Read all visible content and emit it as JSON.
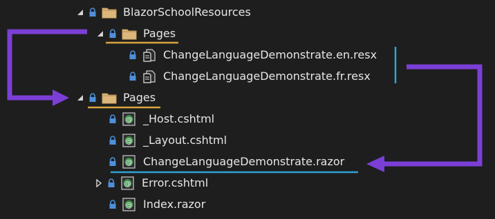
{
  "tree": {
    "root_folder": "BlazorSchoolResources",
    "resources_pages_folder": "Pages",
    "resx_files": [
      "ChangeLanguageDemonstrate.en.resx",
      "ChangeLanguageDemonstrate.fr.resx"
    ],
    "pages_folder": "Pages",
    "page_files": [
      "_Host.cshtml",
      "_Layout.cshtml",
      "ChangeLanguageDemonstrate.razor",
      "Error.cshtml",
      "Index.razor"
    ]
  },
  "colors": {
    "background": "#1e1e1e",
    "folder_underline": "#d9a441",
    "file_underline": "#2fa3d6",
    "arrow": "#7b3fd6",
    "lock": "#4e8fd9",
    "folder": "#dcb67a",
    "razor_icon": "#3c8f4a"
  },
  "icons": {
    "expanded": "triangle-down-icon",
    "collapsed": "triangle-right-icon",
    "lock": "lock-icon",
    "folder": "folder-icon",
    "resx": "resx-file-icon",
    "razor": "razor-file-icon"
  }
}
